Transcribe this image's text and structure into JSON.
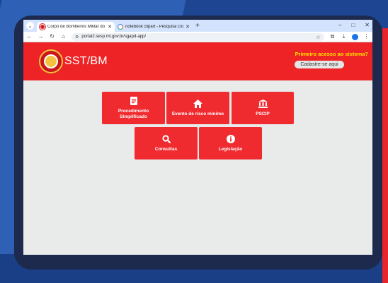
{
  "browser": {
    "tabs": [
      {
        "title": "Corpo de Bombeiros Militar do",
        "active": true,
        "icon": "fire-department-icon"
      },
      {
        "title": "notebook clipart - Pesquisa Go",
        "active": false,
        "icon": "google-icon"
      }
    ],
    "new_tab": "+",
    "window_controls": {
      "minimize": "–",
      "maximize": "□",
      "close": "✕"
    },
    "url": "portal2.sesp.mt.gov.br/sgapd-app/"
  },
  "header": {
    "brand": "SST/BM",
    "first_access": "Primeiro acesso ao sistema?",
    "register_button": "Cadastre-se aqui"
  },
  "tiles": [
    {
      "label_line1": "Procedimento",
      "label_line2": "Simplificado",
      "icon": "document-icon"
    },
    {
      "label_line1": "Evento de risco mínimo",
      "label_line2": "",
      "icon": "house-icon"
    },
    {
      "label_line1": "PSCIP",
      "label_line2": "",
      "icon": "bank-icon"
    },
    {
      "label_line1": "Consultas",
      "label_line2": "",
      "icon": "search-icon"
    },
    {
      "label_line1": "Legislação",
      "label_line2": "",
      "icon": "info-icon"
    }
  ],
  "colors": {
    "header_red": "#ed2326",
    "tile_red": "#ef2b30",
    "highlight_yellow": "#ffe500"
  }
}
